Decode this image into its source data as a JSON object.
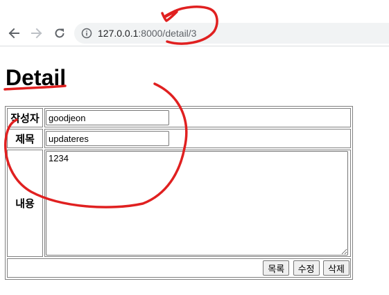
{
  "browser": {
    "url_host": "127.0.0.1",
    "url_rest": ":8000/detail/3",
    "icons": [
      "back-arrow-icon",
      "forward-arrow-icon",
      "reload-icon",
      "info-icon"
    ]
  },
  "page": {
    "title": "Detail"
  },
  "form": {
    "author_label": "작성자",
    "author_value": "goodjeon",
    "title_label": "제목",
    "title_value": "updateres",
    "content_label": "내용",
    "content_value": "1234"
  },
  "buttons": {
    "list_label": "목록",
    "edit_label": "수정",
    "delete_label": "삭제"
  },
  "colors": {
    "annotation": "#e02020"
  }
}
